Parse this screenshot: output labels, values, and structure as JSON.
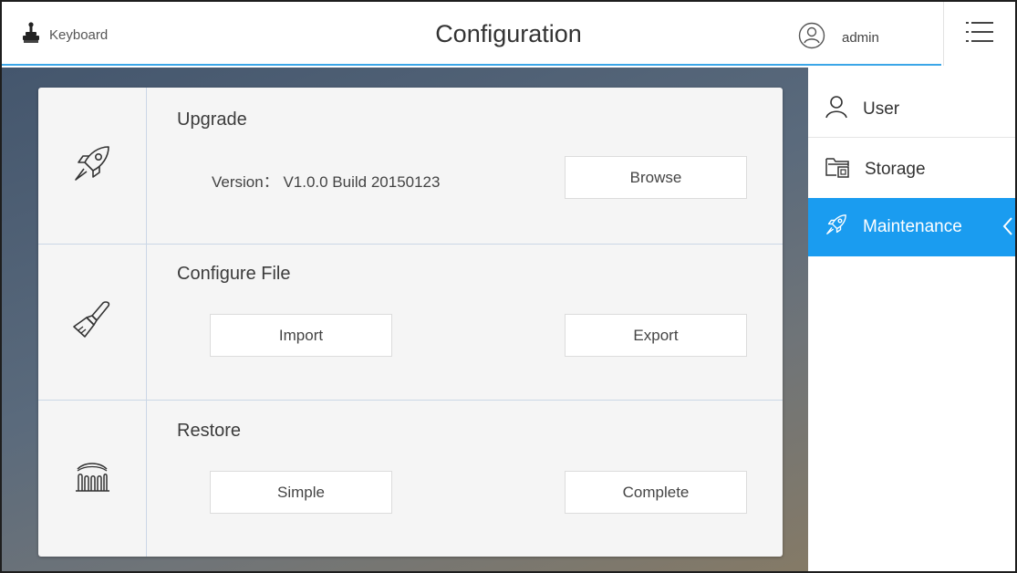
{
  "header": {
    "keyboard_label": "Keyboard",
    "title": "Configuration",
    "user_name": "admin"
  },
  "sections": {
    "upgrade": {
      "title": "Upgrade",
      "version_label": "Version：",
      "version_value": "V1.0.0 Build 20150123",
      "browse_label": "Browse"
    },
    "configure_file": {
      "title": "Configure File",
      "import_label": "Import",
      "export_label": "Export"
    },
    "restore": {
      "title": "Restore",
      "simple_label": "Simple",
      "complete_label": "Complete"
    }
  },
  "sidebar": {
    "items": [
      {
        "label": "User",
        "icon": "user-icon"
      },
      {
        "label": "Storage",
        "icon": "folder-icon"
      },
      {
        "label": "Maintenance",
        "icon": "rocket-icon",
        "active": true
      }
    ]
  },
  "colors": {
    "accent": "#1a9cf0",
    "header_line": "#3ba6e8",
    "card_bg": "#f5f5f5"
  }
}
